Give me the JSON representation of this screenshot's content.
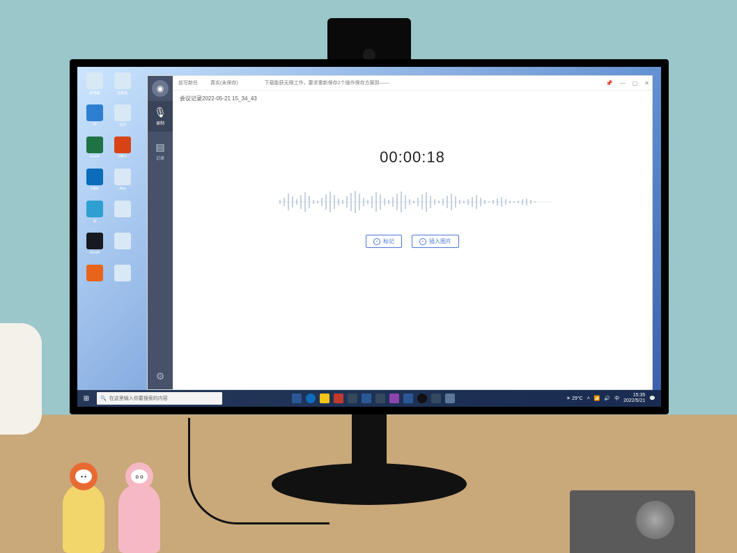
{
  "app": {
    "header": {
      "tab1": "前写新任",
      "tab2": "真实(未保存)",
      "breadcrumb": "下载能获无限工作，要求重新保存2个操作保存方案到——",
      "subtitle": "会议记录2022-05-21 15_34_43"
    },
    "sidebar": {
      "items": [
        {
          "icon": "mic-icon",
          "label": "录制"
        },
        {
          "icon": "list-icon",
          "label": "记录"
        }
      ]
    },
    "recorder": {
      "timer": "00:00:18",
      "btn1": "标记",
      "btn2": "插入图片"
    },
    "window_controls": {
      "pin": "📌",
      "min": "—",
      "max": "▢",
      "close": "✕"
    }
  },
  "taskbar": {
    "search_placeholder": "在这里输入你要搜索的内容",
    "tray": {
      "weather": "☀ 29°C",
      "time": "15:35",
      "date": "2022/5/21"
    }
  },
  "desktop_icons": [
    {
      "label": "此电脑",
      "color": "#d8e8f5"
    },
    {
      "label": "回收站",
      "color": "#d8e8f5"
    },
    {
      "label": "N",
      "color": "#2e7fd1"
    },
    {
      "label": "文件",
      "color": "#d8e8f5"
    },
    {
      "label": "Excel",
      "color": "#1f7244"
    },
    {
      "label": "Office",
      "color": "#d84315"
    },
    {
      "label": "Edge",
      "color": "#0c6cbb"
    },
    {
      "label": "App",
      "color": "#d8e8f5"
    },
    {
      "label": "云",
      "color": "#2e9fd1"
    },
    {
      "label": "",
      "color": "#d8e8f5"
    },
    {
      "label": "Steam",
      "color": "#171a21"
    },
    {
      "label": "",
      "color": "#d8e8f5"
    },
    {
      "label": "",
      "color": "#e8641b"
    },
    {
      "label": "",
      "color": "#d8e8f5"
    }
  ]
}
